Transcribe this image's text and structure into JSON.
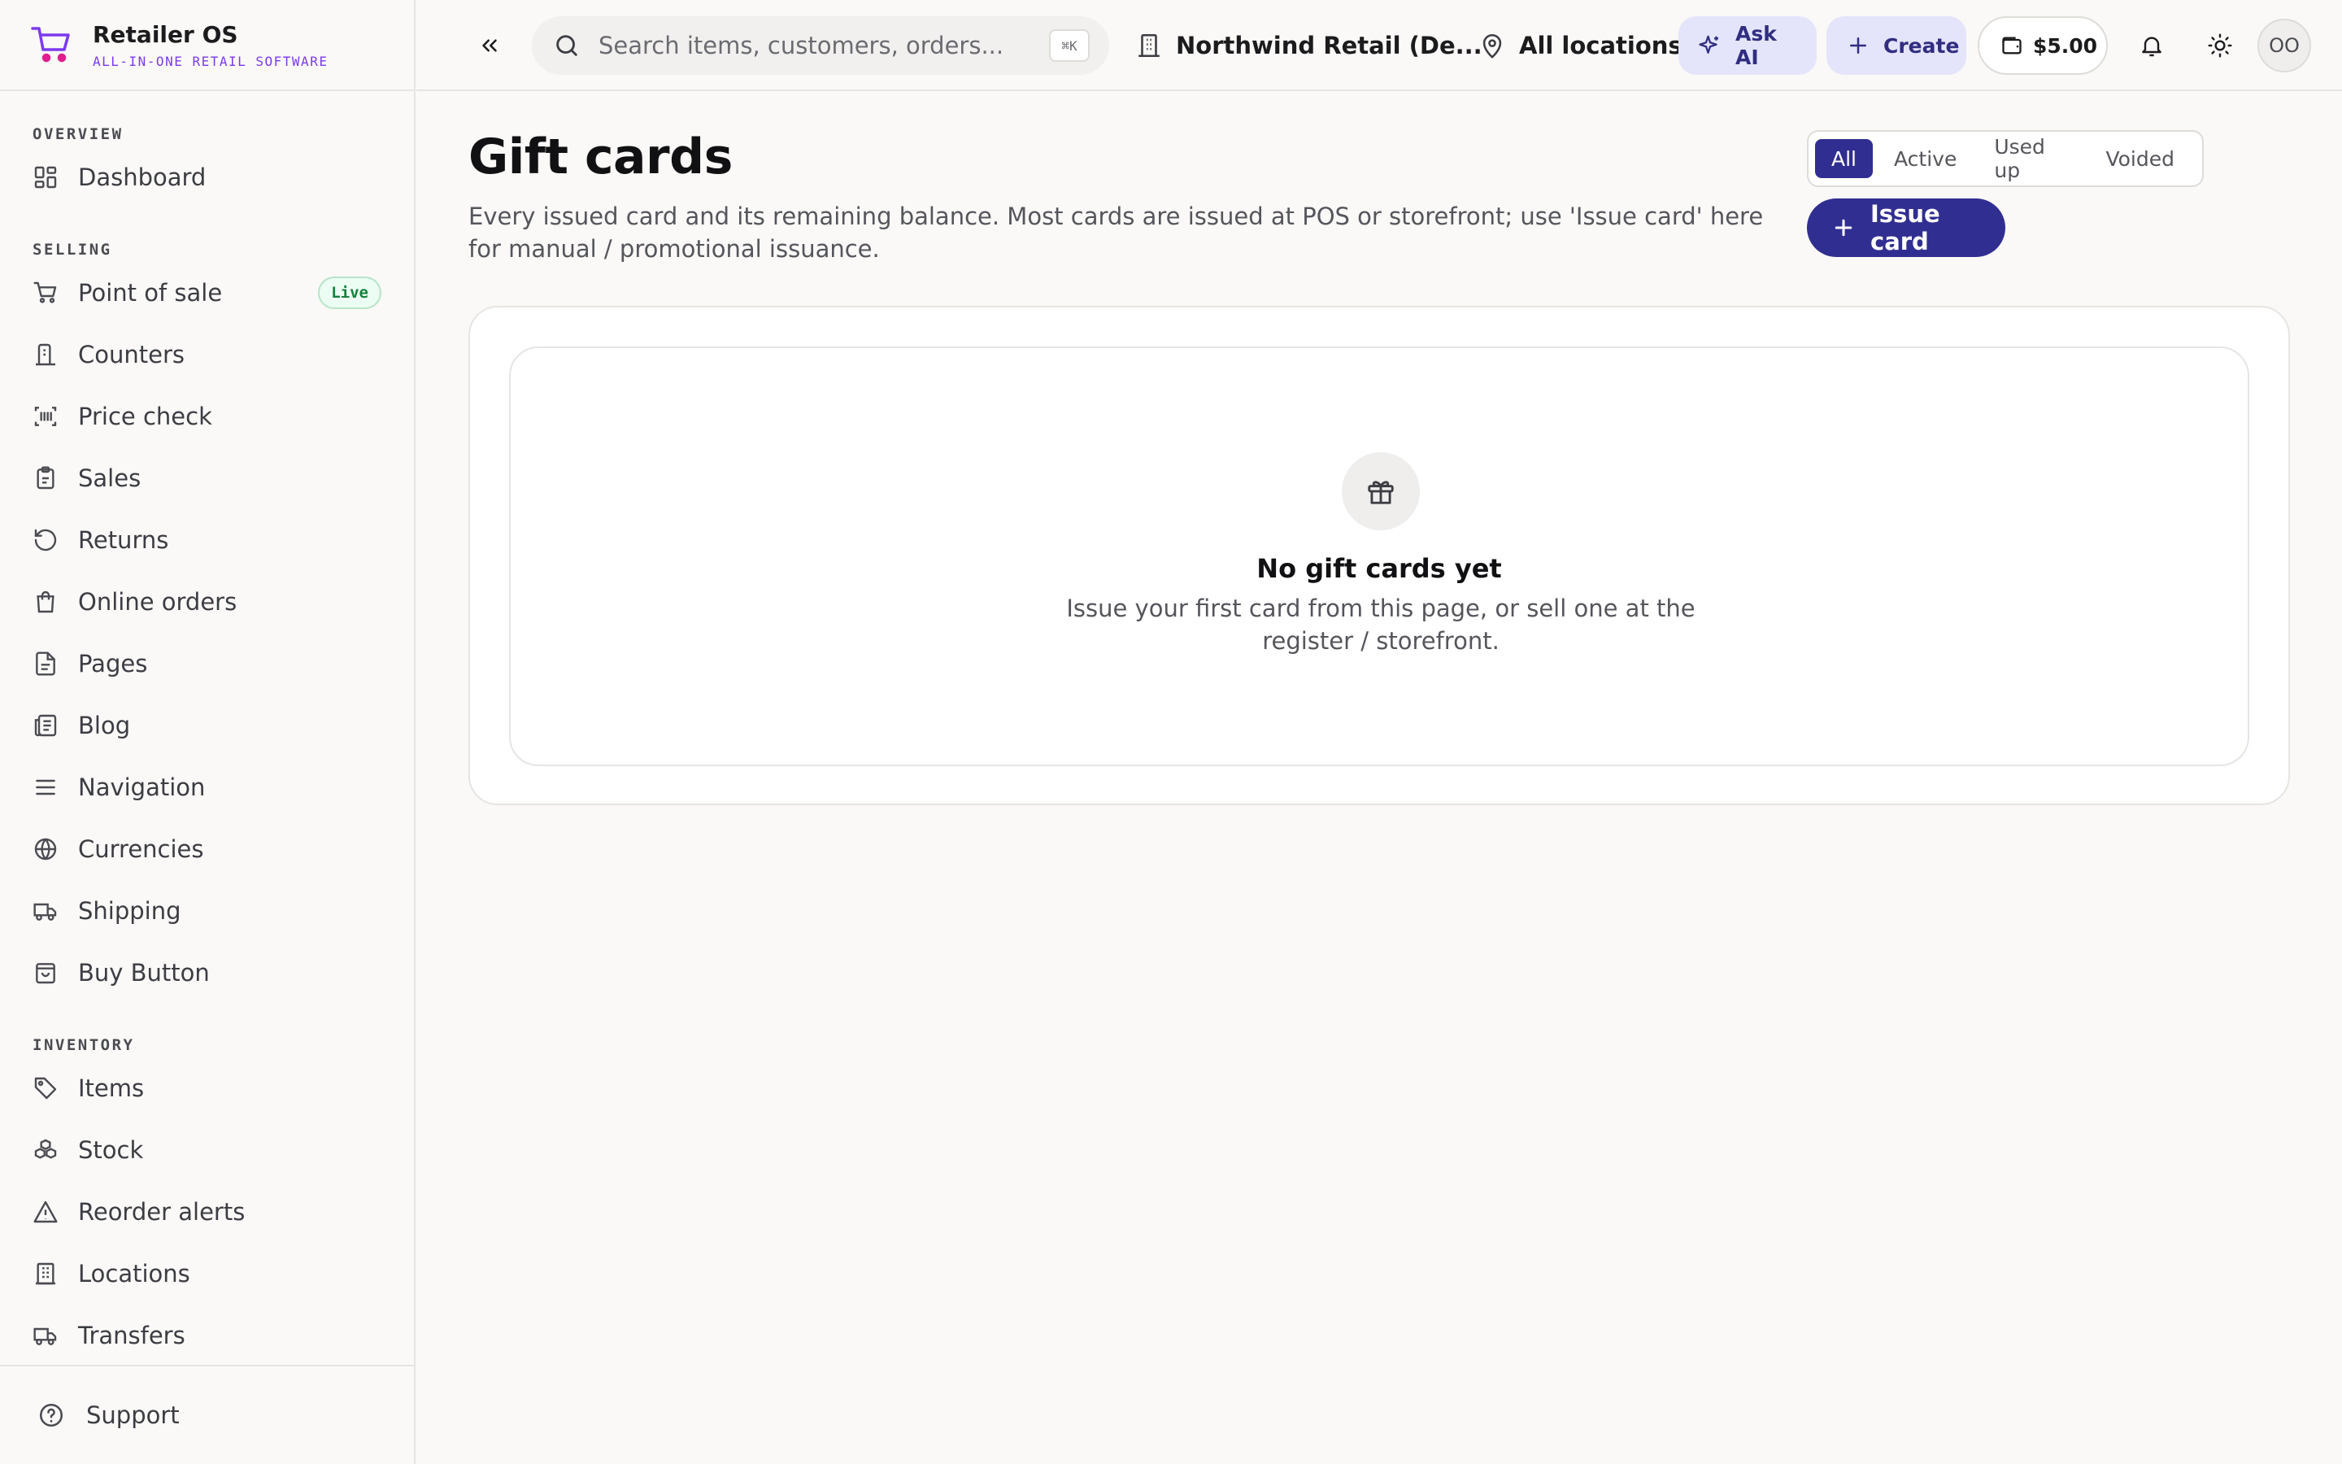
{
  "brand": {
    "name": "Retailer OS",
    "tagline": "ALL-IN-ONE RETAIL SOFTWARE",
    "accent": "#7c3aed"
  },
  "sidebar": {
    "sections": [
      {
        "title": "OVERVIEW",
        "items": [
          {
            "label": "Dashboard",
            "icon": "dashboard-icon"
          }
        ]
      },
      {
        "title": "SELLING",
        "items": [
          {
            "label": "Point of sale",
            "icon": "cart-icon",
            "badge": "Live"
          },
          {
            "label": "Counters",
            "icon": "counter-icon"
          },
          {
            "label": "Price check",
            "icon": "barcode-icon"
          },
          {
            "label": "Sales",
            "icon": "clipboard-icon"
          },
          {
            "label": "Returns",
            "icon": "returns-icon"
          },
          {
            "label": "Online orders",
            "icon": "bag-icon"
          },
          {
            "label": "Pages",
            "icon": "page-icon"
          },
          {
            "label": "Blog",
            "icon": "newspaper-icon"
          },
          {
            "label": "Navigation",
            "icon": "menu-icon"
          },
          {
            "label": "Currencies",
            "icon": "globe-icon"
          },
          {
            "label": "Shipping",
            "icon": "truck-icon"
          },
          {
            "label": "Buy Button",
            "icon": "bag-icon"
          }
        ]
      },
      {
        "title": "INVENTORY",
        "items": [
          {
            "label": "Items",
            "icon": "tag-icon"
          },
          {
            "label": "Stock",
            "icon": "boxes-icon"
          },
          {
            "label": "Reorder alerts",
            "icon": "alert-icon"
          },
          {
            "label": "Locations",
            "icon": "building-icon"
          },
          {
            "label": "Transfers",
            "icon": "truck-icon"
          }
        ]
      }
    ],
    "footer": {
      "label": "Support",
      "icon": "help-icon"
    }
  },
  "topbar": {
    "search_placeholder": "Search items, customers, orders...",
    "search_shortcut": "⌘K",
    "org": "Northwind Retail (De...",
    "location": "All locations",
    "ask_ai": "Ask AI",
    "create": "Create",
    "balance": "$5.00",
    "avatar_initials": "OO"
  },
  "page": {
    "title": "Gift cards",
    "description": "Every issued card and its remaining balance. Most cards are issued at POS or storefront; use 'Issue card' here for manual / promotional issuance.",
    "filters": [
      "All",
      "Active",
      "Used up",
      "Voided"
    ],
    "active_filter": "All",
    "issue_button": "Issue card",
    "empty_state": {
      "title": "No gift cards yet",
      "description": "Issue your first card from this page, or sell one at the register / storefront."
    }
  },
  "colors": {
    "primary": "#312e91",
    "primary_soft": "#e4e4fb",
    "live_green": "#15803d"
  }
}
